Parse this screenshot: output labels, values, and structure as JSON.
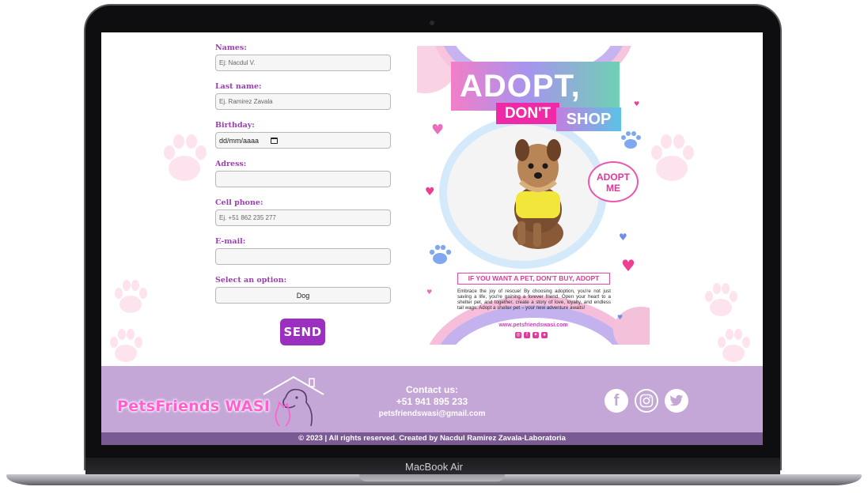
{
  "form": {
    "names": {
      "label": "Names:",
      "placeholder": "Ej: Nacdul V."
    },
    "last_name": {
      "label": "Last name:",
      "placeholder": "Ej. Ramirez Zavala"
    },
    "birthday": {
      "label": "Birthday:",
      "value": "dd/mm/aaaa"
    },
    "adress": {
      "label": "Adress:",
      "placeholder": ""
    },
    "cell_phone": {
      "label": "Cell phone:",
      "placeholder": "Ej. +51 862 235 277"
    },
    "email": {
      "label": "E-mail:",
      "placeholder": ""
    },
    "option": {
      "label": "Select an option:",
      "selected": "Dog"
    },
    "send_label": "SEND"
  },
  "poster": {
    "line1": "ADOPT,",
    "line2": "DON'T",
    "line3": "SHOP",
    "bubble": "ADOPT ME",
    "subtitle": "IF YOU WANT A PET, DON'T BUY, ADOPT",
    "body": "Embrace the joy of rescue! By choosing adoption, you're not just saving a life, you're gaining a forever friend. Open your heart to a shelter pet, and together, create a story of love, loyalty, and endless tail wags. Adopt a shelter pet – your new adventure awaits!",
    "url": "www.petsfriendswasi.com"
  },
  "footer": {
    "logo_text": "PetsFriends WASI",
    "contact_title": "Contact us:",
    "phone": "+51 941 895 233",
    "email": "petsfriendswasi@gmail.com",
    "copyright": "© 2023 | All rights reserved. Created by Nacdul Ramirez Zavala-Laboratoria"
  },
  "device": {
    "label": "MacBook Air"
  },
  "colors": {
    "accent": "#9b2fbf",
    "footer": "#c4a6d7",
    "copyright_bar": "#7b5a93",
    "logo_pink": "#ff5fcf"
  },
  "icons": [
    "calendar-icon",
    "facebook-icon",
    "instagram-icon",
    "twitter-icon"
  ]
}
